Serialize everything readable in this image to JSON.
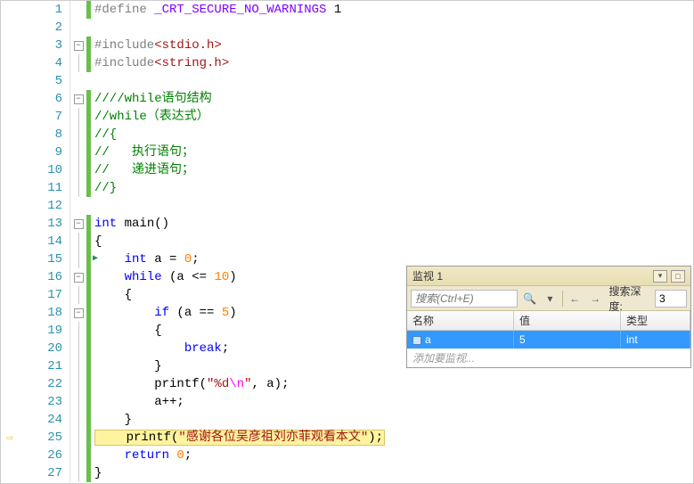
{
  "lines": {
    "count": 27,
    "exec_arrow_line": 25,
    "green_arrow_line": 15
  },
  "code": {
    "l1_define": "#define ",
    "l1_macro": "_CRT_SECURE_NO_WARNINGS",
    "l1_val": " 1",
    "l3_inc": "#include",
    "l3_hdr": "<stdio.h>",
    "l4_inc": "#include",
    "l4_hdr": "<string.h>",
    "l6": "////while语句结构",
    "l7": "//while（表达式）",
    "l8": "//{",
    "l9": "//   执行语句；",
    "l10": "//   递进语句；",
    "l11": "//}",
    "l13_int": "int",
    "l13_main": " main()",
    "l14": "{",
    "l15_int": "    int",
    "l15_rest": " a = ",
    "l15_num": "0",
    "l15_semi": ";",
    "l16_while": "    while",
    "l16_rest": " (a <= ",
    "l16_num": "10",
    "l16_close": ")",
    "l17": "    {",
    "l18_if": "        if",
    "l18_rest": " (a == ",
    "l18_num": "5",
    "l18_close": ")",
    "l19": "        {",
    "l20_break": "            break",
    "l20_semi": ";",
    "l21": "        }",
    "l22_printf": "        printf(",
    "l22_str1": "\"%d",
    "l22_esc": "\\n",
    "l22_str2": "\"",
    "l22_rest": ", a);",
    "l23": "        a++;",
    "l24": "    }",
    "l25_printf": "    printf(",
    "l25_str": "\"感谢各位吴彦祖刘亦菲观看本文\"",
    "l25_close": ");",
    "l26_return": "    return",
    "l26_num": " 0",
    "l26_semi": ";",
    "l27": "}"
  },
  "watch": {
    "title": "监视 1",
    "search_placeholder": "搜索(Ctrl+E)",
    "depth_label": "搜索深度:",
    "depth_value": "3",
    "columns": {
      "name": "名称",
      "value": "值",
      "type": "类型"
    },
    "rows": [
      {
        "name": "a",
        "value": "5",
        "type": "int"
      }
    ],
    "add_hint": "添加要监视..."
  }
}
